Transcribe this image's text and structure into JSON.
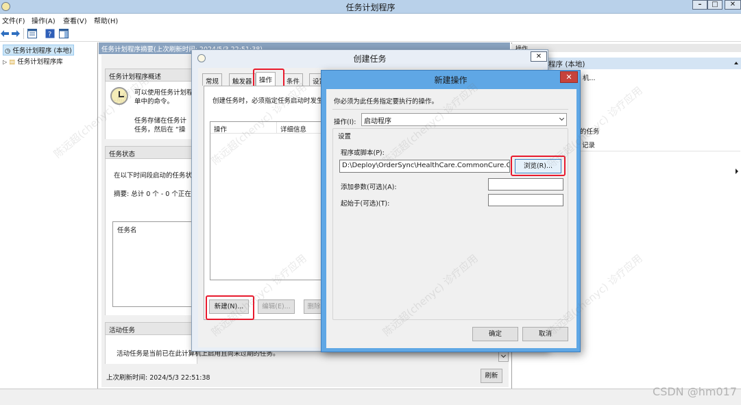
{
  "window": {
    "title": "任务计划程序",
    "min": "–",
    "max": "□",
    "close": "✕"
  },
  "menu": [
    "文件(F)",
    "操作(A)",
    "查看(V)",
    "帮助(H)"
  ],
  "tree": {
    "root": "任务计划程序 (本地)",
    "library": "任务计划程序库"
  },
  "center": {
    "header": "任务计划程序摘要(上次刷新时间: 2024/5/3 22:51:38)",
    "overview_title": "任务计划程序概述",
    "overview_l1": "可以使用任务计划程",
    "overview_l2": "单中的命令。",
    "overview_l3": "任务存储在任务计",
    "overview_l4": "任务，然后在 “操",
    "status_title": "任务状态",
    "status_text": "在以下时间段启动的任务状",
    "summary": "摘要: 总计 0 个 - 0 个正在",
    "task_name_col": "任务名",
    "active_title": "活动任务",
    "active_text": "活动任务是当前已在此计算机上启用且尚未过期的任务。",
    "last_refresh": "上次刷新时间: 2024/5/3 22:51:38",
    "refresh_btn": "刷新"
  },
  "right": {
    "head": "操作",
    "selected": "程序 (本地)",
    "item1": "机...",
    "item2": "的任务",
    "item3": "记录"
  },
  "create_task": {
    "title": "创建任务",
    "close": "✕",
    "tabs": [
      "常规",
      "触发器",
      "操作",
      "条件",
      "设置"
    ],
    "desc": "创建任务时，必须指定任务启动时发生",
    "col_action": "操作",
    "col_detail": "详细信息",
    "new_btn": "新建(N)...",
    "edit_btn": "编辑(E)...",
    "delete_btn": "删除"
  },
  "new_action": {
    "title": "新建操作",
    "close": "✕",
    "instruction": "你必须为此任务指定要执行的操作。",
    "action_label": "操作(I):",
    "action_value": "启动程序",
    "settings_label": "设置",
    "program_label": "程序或脚本(P):",
    "program_value": "D:\\Deploy\\OrderSync\\HealthCare.CommonCure.Con",
    "browse_btn": "浏览(R)...",
    "args_label": "添加参数(可选)(A):",
    "start_label": "起始于(可选)(T):",
    "ok_btn": "确定",
    "cancel_btn": "取消"
  },
  "watermark": "陈远超(chenyc) 诊疗应用",
  "credit": "CSDN @hm017"
}
